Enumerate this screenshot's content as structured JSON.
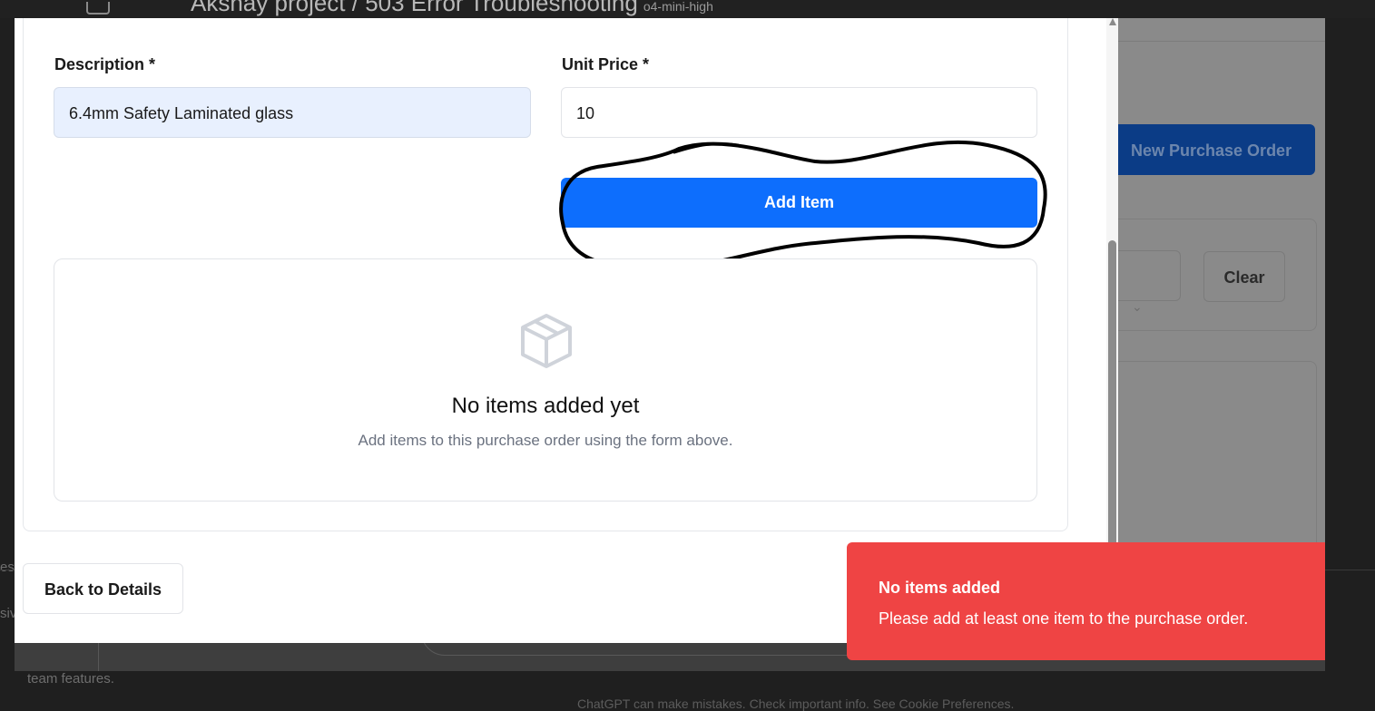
{
  "background": {
    "breadcrumb_title": "Akshay project / 503 Error Troubleshooting",
    "model_label": "o4-mini-high",
    "new_po_button": "New Purchase Order",
    "clear_button": "Clear",
    "left_fragment_1": "es",
    "left_fragment_2": "siv",
    "left_fragment_3": "team features.",
    "footer_text": "ChatGPT can make mistakes. Check important info. See Cookie Preferences."
  },
  "form": {
    "description_label": "Description *",
    "description_value": "6.4mm Safety Laminated glass",
    "unit_price_label": "Unit Price *",
    "unit_price_value": "10",
    "add_item_button": "Add Item"
  },
  "empty_state": {
    "icon": "package-icon",
    "title": "No items added yet",
    "subtitle": "Add items to this purchase order using the form above."
  },
  "footer": {
    "back_button": "Back to Details"
  },
  "toast": {
    "title": "No items added",
    "message": "Please add at least one item to the purchase order.",
    "color": "#ef4444"
  },
  "colors": {
    "primary": "#0d6efd",
    "autofill_bg": "#e8f0fe",
    "annotation": "#000000"
  }
}
